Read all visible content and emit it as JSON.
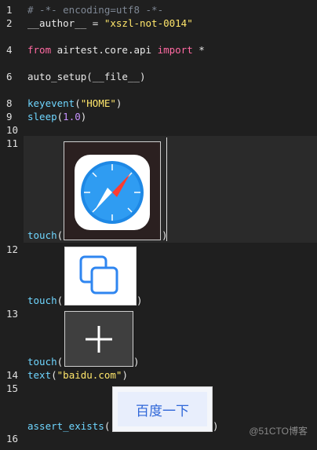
{
  "line_numbers": [
    "1",
    "2",
    "4",
    "6",
    "8",
    "9",
    "10",
    "11",
    "12",
    "13",
    "14",
    "15",
    "16"
  ],
  "lines": {
    "l1": "# -*- encoding=utf8 -*-",
    "l2_a": "__author__ = ",
    "l2_b": "\"xszl-not-0014\"",
    "l4_a": "from",
    "l4_b": " airtest.core.api ",
    "l4_c": "import",
    "l4_d": " *",
    "l6": "auto_setup(__file__)",
    "l8_a": "keyevent",
    "l8_b": "(",
    "l8_c": "\"HOME\"",
    "l8_d": ")",
    "l9_a": "sleep",
    "l9_b": "(",
    "l9_c": "1.0",
    "l9_d": ")",
    "l11_fn": "touch",
    "l11_open": "(",
    "l11_close": ")",
    "l12_fn": "touch",
    "l12_open": "(",
    "l12_close": ")",
    "l13_fn": "touch",
    "l13_open": "(",
    "l13_close": ")",
    "l14_a": "text",
    "l14_b": "(",
    "l14_c": "\"baidu.com\"",
    "l14_d": ")",
    "l15_fn": "assert_exists",
    "l15_open": "(",
    "l15_close": ")"
  },
  "images": {
    "safari": "safari-icon",
    "copy": "copy-tabs-icon",
    "plus": "plus-icon",
    "baidu_button_text": "百度一下"
  },
  "watermark": "@51CTO博客",
  "colors": {
    "background": "#1f1f1f",
    "keyword": "#ff6aa2",
    "string": "#ffe66b",
    "number": "#c792ff",
    "function": "#6fd6ff",
    "comment": "#7e8794"
  }
}
